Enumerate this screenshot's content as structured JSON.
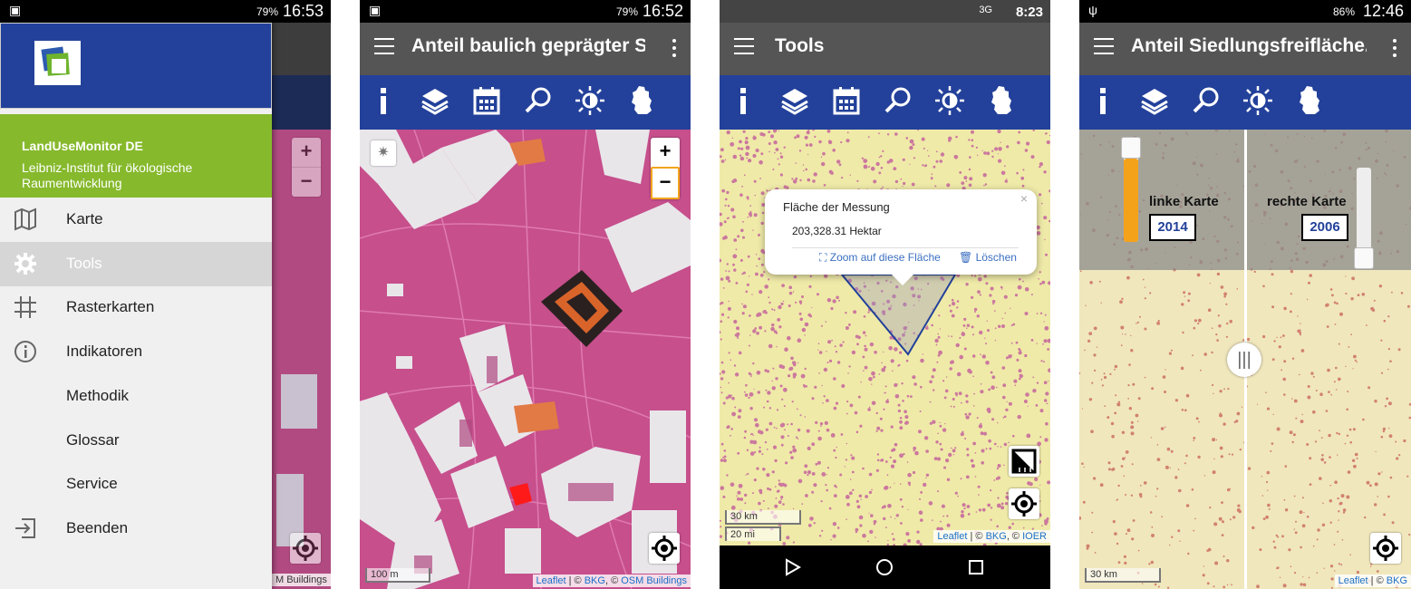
{
  "phones": [
    {
      "status": {
        "battery": "79%",
        "time": "16:53"
      },
      "drawer": {
        "app_name": "LandUseMonitor DE",
        "org": "Leibniz-Institut für ökologische Raumentwicklung",
        "items": [
          {
            "label": "Karte",
            "icon": "map-icon"
          },
          {
            "label": "Tools",
            "icon": "gear-icon"
          },
          {
            "label": "Rasterkarten",
            "icon": "grid-icon"
          },
          {
            "label": "Indikatoren",
            "icon": "info-icon"
          },
          {
            "label": "Methodik",
            "icon": ""
          },
          {
            "label": "Glossar",
            "icon": ""
          },
          {
            "label": "Service",
            "icon": ""
          },
          {
            "label": "Beenden",
            "icon": "exit-icon"
          }
        ]
      },
      "attribution": "M Buildings"
    },
    {
      "status": {
        "battery": "79%",
        "time": "16:52"
      },
      "title": "Anteil baulich geprägter Sied",
      "scale": "100 m",
      "attribution": {
        "leaflet": "Leaflet",
        "sep": "| ©",
        "bkg": "BKG",
        "mid": ", ©",
        "osm": "OSM Buildings"
      }
    },
    {
      "status": {
        "network": "3G",
        "time": "8:23"
      },
      "title": "Tools",
      "popup": {
        "title": "Fläche der Messung",
        "value": "203,328.31 Hektar",
        "zoom": "Zoom auf diese Fläche",
        "delete": "Löschen",
        "close": "×"
      },
      "scale_km": "30 km",
      "scale_mi": "20 mi",
      "attribution": {
        "leaflet": "Leaflet",
        "sep": "| ©",
        "bkg": "BKG",
        "mid": ", ©",
        "ioer": "IOER"
      }
    },
    {
      "status": {
        "battery": "86%",
        "time": "12:46"
      },
      "title": "Anteil Siedlungsfreifläche...",
      "left_label": "linke Karte",
      "left_year": "2014",
      "right_label": "rechte Karte",
      "right_year": "2006",
      "scale": "30 km",
      "attribution": {
        "leaflet": "Leaflet",
        "sep": "| ©",
        "bkg": "BKG"
      }
    }
  ],
  "colors": {
    "accent_blue": "#23419a",
    "drawer_green": "#86b92c",
    "appbar_gray": "#555555",
    "pink": "#c8528f",
    "slider_orange": "#f5a21b"
  }
}
